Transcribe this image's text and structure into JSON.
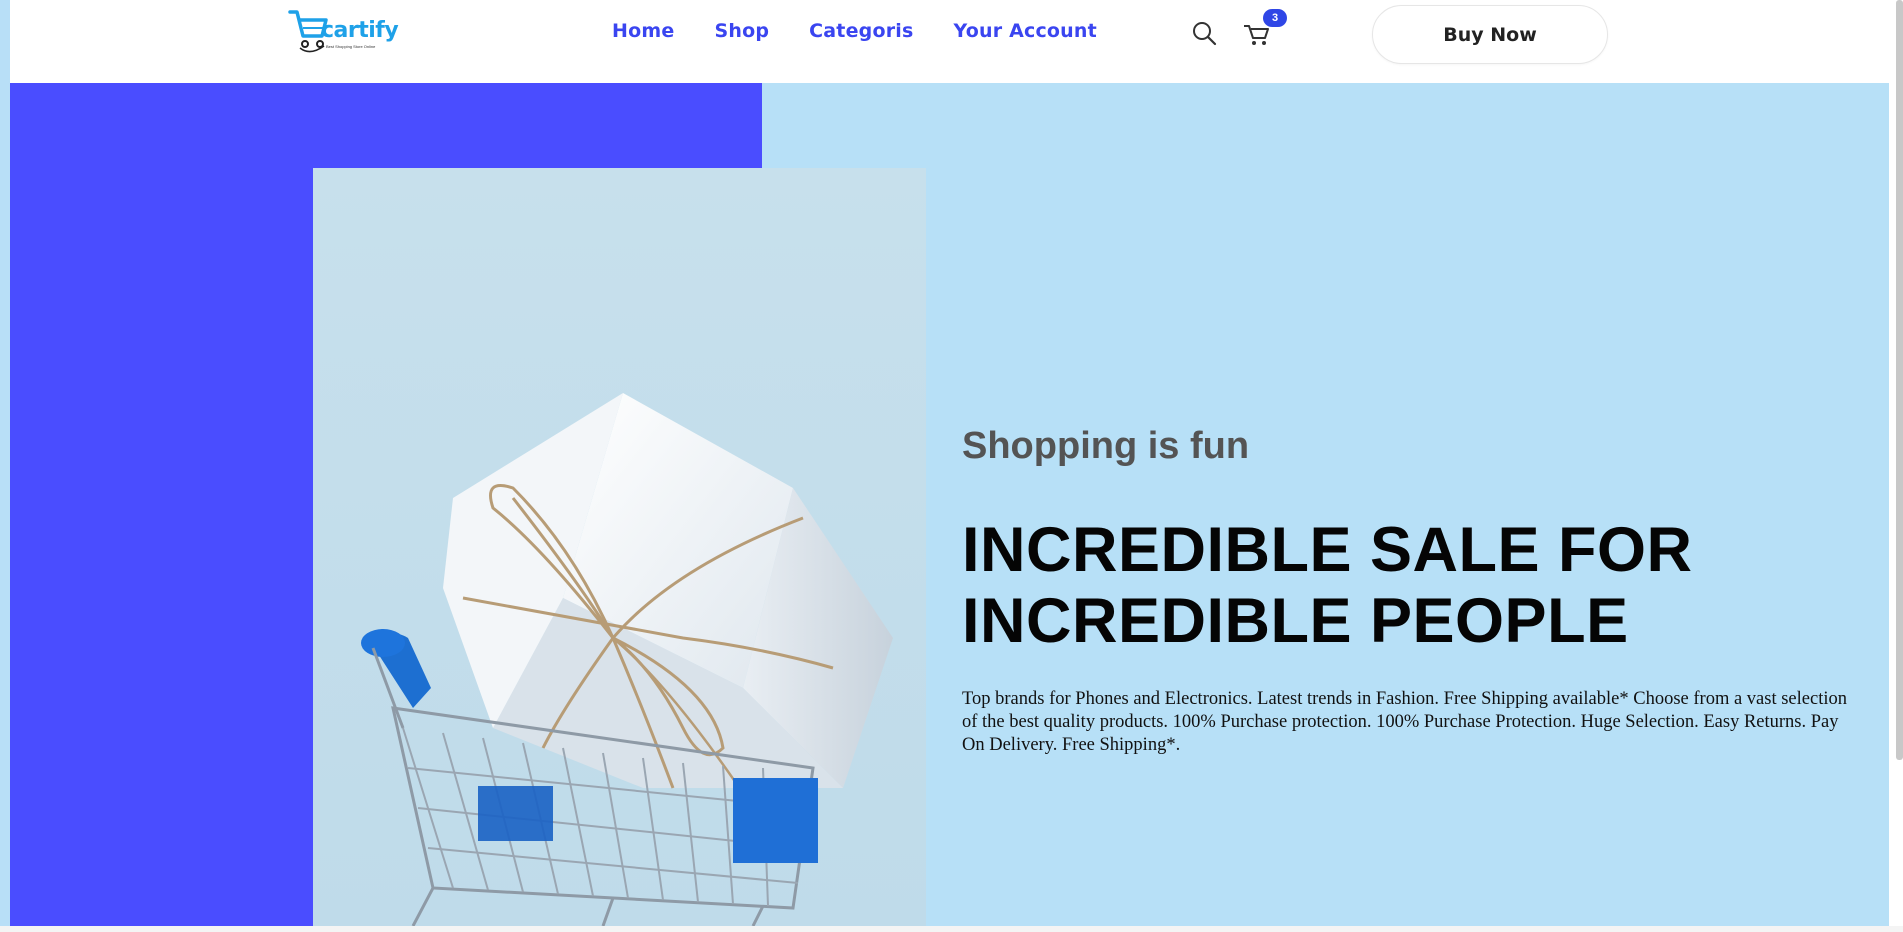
{
  "header": {
    "logo": {
      "name": "cartify",
      "tagline": "Best Shopping Store Online"
    },
    "nav": [
      {
        "label": "Home"
      },
      {
        "label": "Shop"
      },
      {
        "label": "Categoris"
      },
      {
        "label": "Your Account"
      }
    ],
    "cart_count": "3",
    "buy_button": "Buy Now"
  },
  "hero": {
    "subtitle": "Shopping is fun",
    "headline_line1": "INCREDIBLE SALE FOR",
    "headline_line2": "INCREDIBLE PEOPLE",
    "description": "Top brands for Phones and Electronics. Latest trends in Fashion. Free Shipping available* Choose from a vast selection of the best quality products. 100% Purchase protection. 100% Purchase Protection. Huge Selection. Easy Returns. Pay On Delivery. Free Shipping*."
  },
  "colors": {
    "accent_blue": "#4a4dff",
    "hero_background": "#b7e0f7",
    "nav_text": "#3a45f0",
    "logo": "#1ea1e8"
  },
  "icons": {
    "search": "search-icon",
    "cart": "cart-icon",
    "logo": "shopping-cart-logo-icon"
  }
}
